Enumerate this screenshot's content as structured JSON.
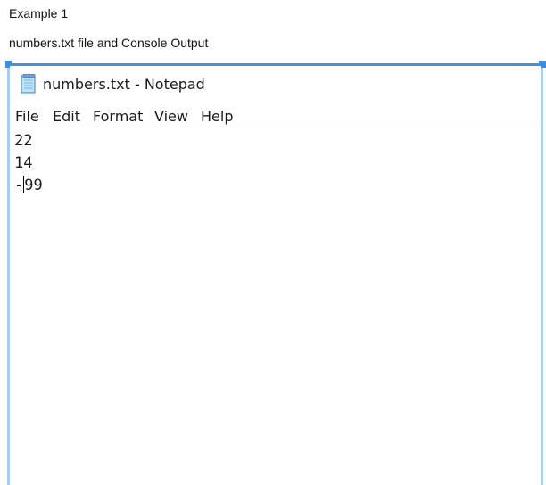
{
  "document": {
    "line1": "Example 1",
    "line2": "numbers.txt file and Console Output"
  },
  "notepad": {
    "title": "numbers.txt - Notepad",
    "icon": "notepad-icon",
    "menu": [
      "File",
      "Edit",
      "Format",
      "View",
      "Help"
    ],
    "content": {
      "lines": [
        "22",
        "14",
        "-99"
      ],
      "line3_before_caret": "-",
      "line3_after_caret": "99"
    }
  },
  "colors": {
    "selection_frame": "#4a8fd8",
    "selection_side": "#a9cdf1"
  }
}
